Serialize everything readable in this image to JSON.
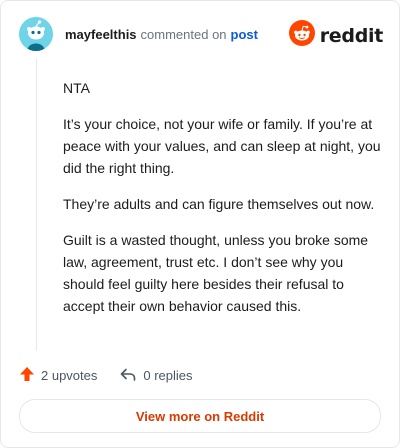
{
  "comment": {
    "username": "mayfeelthis",
    "action_text": "commented on",
    "post_link": "post",
    "paragraphs": [
      "NTA",
      "It’s your choice, not your wife or family. If you’re at peace with your values, and can sleep at night, you did the right thing.",
      "They’re adults and can figure themselves out now.",
      "Guilt is a wasted thought, unless you broke some law, agreement, trust etc. I don’t see why you should feel guilty here besides their refusal to accept their own behavior caused this."
    ]
  },
  "brand": {
    "name": "reddit",
    "logo_color": "#ff4500"
  },
  "footer": {
    "upvotes": "2 upvotes",
    "replies": "0 replies",
    "view_more": "View more on Reddit"
  },
  "icons": {
    "avatar": "snoo-avatar-icon",
    "logo": "reddit-logo-icon",
    "upvote": "upvote-arrow-icon",
    "reply": "reply-arrow-icon"
  }
}
